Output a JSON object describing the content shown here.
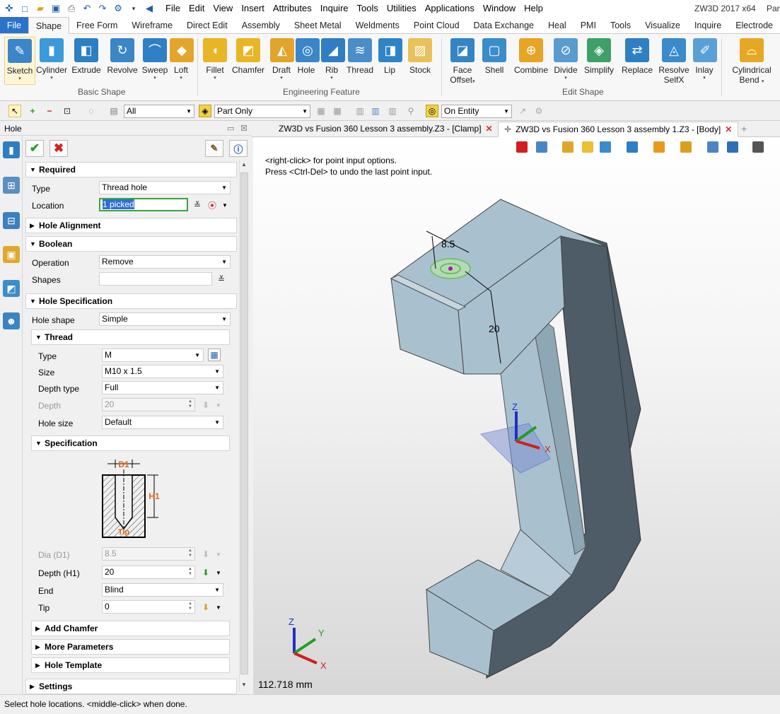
{
  "titlebar": {
    "menu": [
      "File",
      "Edit",
      "View",
      "Insert",
      "Attributes",
      "Inquire",
      "Tools",
      "Utilities",
      "Applications",
      "Window",
      "Help"
    ],
    "app_title": "ZW3D 2017  x64",
    "clipped_right": "Par"
  },
  "ribbon_tabs": [
    "File",
    "Shape",
    "Free Form",
    "Wireframe",
    "Direct Edit",
    "Assembly",
    "Sheet Metal",
    "Weldments",
    "Point Cloud",
    "Data Exchange",
    "Heal",
    "PMI",
    "Tools",
    "Visualize",
    "Inquire",
    "Electrode"
  ],
  "ribbon": {
    "buttons": [
      {
        "label": "Sketch",
        "dd": "▾"
      },
      {
        "label": "Cylinder",
        "dd": "▾"
      },
      {
        "label": "Extrude",
        "dd": ""
      },
      {
        "label": "Revolve",
        "dd": ""
      },
      {
        "label": "Sweep",
        "dd": "▾"
      },
      {
        "label": "Loft",
        "dd": "▾"
      },
      {
        "label": "Fillet",
        "dd": "▾"
      },
      {
        "label": "Chamfer",
        "dd": ""
      },
      {
        "label": "Draft",
        "dd": "▾"
      },
      {
        "label": "Hole",
        "dd": ""
      },
      {
        "label": "Rib",
        "dd": "▾"
      },
      {
        "label": "Thread",
        "dd": ""
      },
      {
        "label": "Lip",
        "dd": ""
      },
      {
        "label": "Stock",
        "dd": ""
      },
      {
        "label": "Face",
        "label2": "Offset",
        "dd": "▾"
      },
      {
        "label": "Shell",
        "dd": ""
      },
      {
        "label": "Combine",
        "dd": ""
      },
      {
        "label": "Divide",
        "dd": "▾"
      },
      {
        "label": "Simplify",
        "dd": ""
      },
      {
        "label": "Replace",
        "dd": ""
      },
      {
        "label": "Resolve",
        "label2": "SelfX",
        "dd": ""
      },
      {
        "label": "Inlay",
        "dd": "▾"
      },
      {
        "label": "Cylindrical",
        "label2": "Bend",
        "dd": "▾"
      }
    ],
    "groups": [
      "Basic Shape",
      "Engineering Feature",
      "Edit Shape"
    ]
  },
  "filterbar": {
    "filter_all": "All",
    "part_only": "Part Only",
    "on_entity": "On Entity"
  },
  "panel": {
    "title": "Hole",
    "required": {
      "header": "Required",
      "type_label": "Type",
      "type_value": "Thread hole",
      "location_label": "Location",
      "location_value": "1 picked"
    },
    "hole_alignment": "Hole Alignment",
    "boolean": {
      "header": "Boolean",
      "operation_label": "Operation",
      "operation_value": "Remove",
      "shapes_label": "Shapes",
      "shapes_value": ""
    },
    "hole_spec": {
      "header": "Hole Specification",
      "hole_shape_label": "Hole shape",
      "hole_shape_value": "Simple"
    },
    "thread": {
      "header": "Thread",
      "type_label": "Type",
      "type_value": "M",
      "size_label": "Size",
      "size_value": "M10 x 1.5",
      "depth_type_label": "Depth type",
      "depth_type_value": "Full",
      "depth_label": "Depth",
      "depth_value": "20",
      "hole_size_label": "Hole size",
      "hole_size_value": "Default"
    },
    "specification": {
      "header": "Specification",
      "diagram": {
        "d1": "D1",
        "h1": "H1",
        "tip": "Tip"
      },
      "dia_label": "Dia (D1)",
      "dia_value": "8.5",
      "depth_label": "Depth (H1)",
      "depth_value": "20",
      "end_label": "End",
      "end_value": "Blind",
      "tip_label": "Tip",
      "tip_value": "0"
    },
    "collapsed": [
      "Add Chamfer",
      "More Parameters",
      "Hole Template"
    ],
    "settings": "Settings"
  },
  "doc_tabs": [
    {
      "label": "ZW3D vs Fusion 360 Lesson 3 assembly.Z3 - [Clamp]",
      "active": false
    },
    {
      "label": "ZW3D vs Fusion 360 Lesson 3 assembly 1.Z3 - [Body]",
      "active": true
    }
  ],
  "viewport": {
    "hint1": "<right-click> for point input options.",
    "hint2": "Press <Ctrl-Del> to undo the last point input.",
    "dim_85": "8.5",
    "dim_20": "20",
    "axis_labels": {
      "x": "X",
      "y": "Y",
      "z": "Z"
    },
    "measure": "112.718 mm"
  },
  "statusbar": "Select hole locations.  <middle-click> when done.",
  "colors": {
    "accent": "#2b73c9",
    "model": "#a9c1cf",
    "model_dark": "#4d5c66",
    "ok_green": "#2a9d2a",
    "cancel_red": "#d02020"
  }
}
